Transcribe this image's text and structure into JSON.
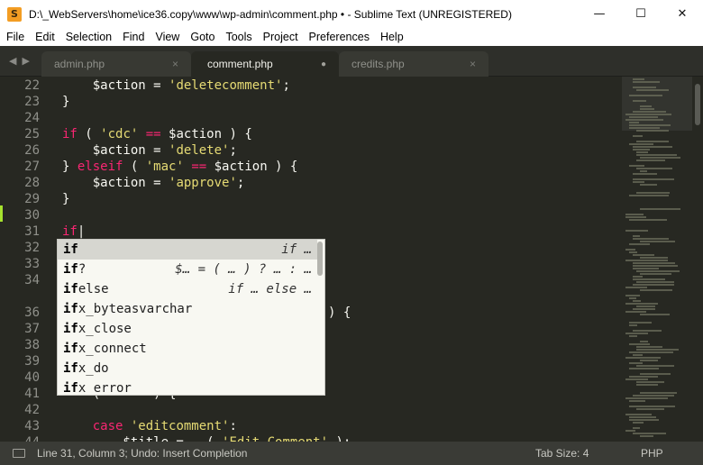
{
  "window": {
    "title": "D:\\_WebServers\\home\\ice36.copy\\www\\wp-admin\\comment.php • - Sublime Text (UNREGISTERED)",
    "app_icon": "sublime-icon",
    "controls": {
      "minimize": "—",
      "maximize": "☐",
      "close": "✕"
    }
  },
  "menu": [
    "File",
    "Edit",
    "Selection",
    "Find",
    "View",
    "Goto",
    "Tools",
    "Project",
    "Preferences",
    "Help"
  ],
  "tabs": [
    {
      "label": "admin.php",
      "close": "×",
      "active": false
    },
    {
      "label": "comment.php",
      "close": "●",
      "active": true
    },
    {
      "label": "credits.php",
      "close": "×",
      "active": false
    }
  ],
  "nav_arrows": "◀▶",
  "editor": {
    "lines": [
      {
        "num": "22",
        "tokens": [
          [
            "plain",
            "    $action = "
          ],
          [
            "str",
            "'deletecomment'"
          ],
          [
            "plain",
            ";"
          ]
        ]
      },
      {
        "num": "23",
        "tokens": [
          [
            "plain",
            "}"
          ]
        ]
      },
      {
        "num": "24",
        "tokens": []
      },
      {
        "num": "25",
        "tokens": [
          [
            "kw",
            "if"
          ],
          [
            "plain",
            " ( "
          ],
          [
            "str",
            "'cdc'"
          ],
          [
            "plain",
            " "
          ],
          [
            "kw",
            "=="
          ],
          [
            "plain",
            " $action ) {"
          ]
        ]
      },
      {
        "num": "26",
        "tokens": [
          [
            "plain",
            "    $action = "
          ],
          [
            "str",
            "'delete'"
          ],
          [
            "plain",
            ";"
          ]
        ]
      },
      {
        "num": "27",
        "tokens": [
          [
            "plain",
            "} "
          ],
          [
            "kw",
            "elseif"
          ],
          [
            "plain",
            " ( "
          ],
          [
            "str",
            "'mac'"
          ],
          [
            "plain",
            " "
          ],
          [
            "kw",
            "=="
          ],
          [
            "plain",
            " $action ) {"
          ]
        ]
      },
      {
        "num": "28",
        "tokens": [
          [
            "plain",
            "    $action = "
          ],
          [
            "str",
            "'approve'"
          ],
          [
            "plain",
            ";"
          ]
        ]
      },
      {
        "num": "29",
        "tokens": [
          [
            "plain",
            "}"
          ]
        ]
      },
      {
        "num": "30",
        "tokens": []
      },
      {
        "num": "31",
        "tokens": [
          [
            "kw",
            "if"
          ],
          [
            "plain",
            "|"
          ]
        ]
      },
      {
        "num": "32",
        "tokens": []
      },
      {
        "num": "33",
        "tokens": []
      },
      {
        "num": "34",
        "tokens": []
      },
      {
        "num": "36",
        "tokens": [
          [
            "plain",
            "                                 ] ) {"
          ]
        ]
      },
      {
        "num": "37",
        "tokens": []
      },
      {
        "num": "38",
        "tokens": []
      },
      {
        "num": "39",
        "tokens": []
      },
      {
        "num": "40",
        "tokens": []
      },
      {
        "num": "41",
        "tokens": [
          [
            "plain",
            "    (       ) {"
          ]
        ]
      },
      {
        "num": "42",
        "tokens": []
      },
      {
        "num": "43",
        "tokens": [
          [
            "plain",
            "    "
          ],
          [
            "kw",
            "case"
          ],
          [
            "plain",
            " "
          ],
          [
            "str",
            "'editcomment'"
          ],
          [
            "plain",
            ":"
          ]
        ]
      },
      {
        "num": "44",
        "tokens": [
          [
            "plain",
            "        $title = __( "
          ],
          [
            "str",
            "'Edit Comment'"
          ],
          [
            "plain",
            " );"
          ]
        ]
      }
    ]
  },
  "autocomplete": {
    "items": [
      {
        "bold": "if",
        "rest": "",
        "hint": "if …",
        "selected": true
      },
      {
        "bold": "if",
        "rest": "?",
        "hint": "$… = ( … ) ? … : …",
        "selected": false
      },
      {
        "bold": "if",
        "rest": "else",
        "hint": "if … else …",
        "selected": false
      },
      {
        "bold": "if",
        "rest": "x_byteasvarchar",
        "hint": "",
        "selected": false
      },
      {
        "bold": "if",
        "rest": "x_close",
        "hint": "",
        "selected": false
      },
      {
        "bold": "if",
        "rest": "x_connect",
        "hint": "",
        "selected": false
      },
      {
        "bold": "if",
        "rest": "x_do",
        "hint": "",
        "selected": false
      },
      {
        "bold": "if",
        "rest": "x_error",
        "hint": "",
        "selected": false
      }
    ]
  },
  "status": {
    "icon": "panel-icon",
    "text": "Line 31, Column 3; Undo: Insert Completion",
    "tab_size": "Tab Size: 4",
    "syntax": "PHP"
  },
  "colors": {
    "background": "#272822",
    "keyword": "#f92672",
    "string": "#e6db74",
    "text": "#f8f8f2",
    "line_number": "#8f908a",
    "modified_marker": "#a6e22e"
  }
}
